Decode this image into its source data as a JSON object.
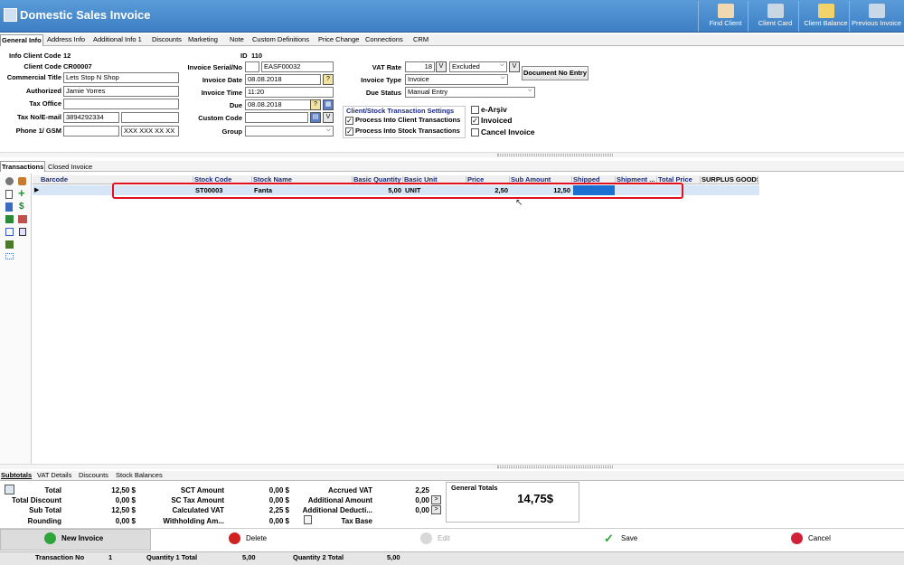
{
  "window": {
    "title": "Domestic Sales Invoice"
  },
  "toolbar": [
    {
      "label": "Find Client",
      "icon": "find-client-icon",
      "color": "#f0d8b0"
    },
    {
      "label": "Client Card",
      "icon": "client-card-icon",
      "color": "#c9d7e3"
    },
    {
      "label": "Client Balance",
      "icon": "client-balance-icon",
      "color": "#f1d36a"
    },
    {
      "label": "Previous Invoice",
      "icon": "previous-invoice-icon",
      "color": "#c8d8e8"
    }
  ],
  "tabs": [
    "General Info",
    "Address Info",
    "Additional Info 1",
    "Discounts",
    "Marketing",
    "Note",
    "Custom Definitions",
    "Price Change",
    "Connections",
    "CRM"
  ],
  "client": {
    "info_code_label": "Info Client Code",
    "info_code_value": "12",
    "code_label": "Client Code",
    "code_value": "CR00007",
    "commercial_title_label": "Commercial Title",
    "commercial_title_value": "Lets Stop N Shop",
    "authorized_label": "Authorized",
    "authorized_value": "Jamie  Yorres",
    "tax_office_label": "Tax Office",
    "tax_office_value": "",
    "tax_no_label": "Tax No/E-mail",
    "tax_no_value": "3894292334",
    "phone_label": "Phone 1/ GSM",
    "phone_gsm_value": "XXX XXX XX XX"
  },
  "invoice": {
    "id_label": "ID",
    "id_value": "110",
    "serial_label": "Invoice Serial/No",
    "serial_value": "EASF00032",
    "date_label": "Invoice Date",
    "date_value": "08.08.2018",
    "time_label": "Invoice Time",
    "time_value": "11:20",
    "due_label": "Due",
    "due_value": "08.08.2018",
    "custom_code_label": "Custom Code",
    "custom_code_value": "",
    "group_label": "Group",
    "group_value": "",
    "vat_rate_label": "VAT Rate",
    "vat_rate_value": "18",
    "vat_v": "V",
    "vat_mode_value": "Excluded",
    "vat_mode_v": "V",
    "document_no_entry": "Document No Entry",
    "type_label": "Invoice Type",
    "type_value": "Invoice",
    "due_status_label": "Due Status",
    "due_status_value": "Manual Entry"
  },
  "settings": {
    "title": "Client/Stock Transaction Settings",
    "process_client": "Process Into Client Transactions",
    "process_client_checked": true,
    "process_stock": "Process Into Stock Transactions",
    "process_stock_checked": true
  },
  "options": {
    "earsiv": "e-Arşiv",
    "earsiv_checked": false,
    "invoiced": "Invoiced",
    "invoiced_checked": true,
    "cancel": "Cancel Invoice",
    "cancel_checked": false
  },
  "transaction_tabs": [
    "Transactions",
    "Closed Invoice"
  ],
  "grid": {
    "columns": [
      "Barcode",
      "Stock Code",
      "Stock Name",
      "Basic Quantity",
      "Basic Unit",
      "Price",
      "Sub Amount",
      "Shipped",
      "Shipment ...",
      "Total Price",
      "SURPLUS GOODS"
    ],
    "rows": [
      {
        "barcode": "",
        "stock_code": "ST00003",
        "stock_name": "Fanta",
        "quantity": "5,00",
        "unit": "UNIT",
        "price": "2,50",
        "sub_amount": "12,50",
        "shipped": "",
        "shipment": "",
        "total_price": "",
        "surplus": ""
      }
    ],
    "highlight_color": "#e0101c",
    "selected_color": "#1a6fd0"
  },
  "subtotal_tabs": [
    "Subtotals",
    "VAT Details",
    "Discounts",
    "Stock Balances"
  ],
  "subtotals": {
    "total_label": "Total",
    "total": "12,50 $",
    "total_discount_label": "Total Discount",
    "total_discount": "0,00 $",
    "sub_total_label": "Sub Total",
    "sub_total": "12,50 $",
    "rounding_label": "Rounding",
    "rounding": "0,00 $",
    "sct_label": "SCT Amount",
    "sct": "0,00 $",
    "sct_tax_label": "SC Tax Amount",
    "sct_tax": "0,00 $",
    "calc_vat_label": "Calculated VAT",
    "calc_vat": "2,25 $",
    "withholding_label": "Withholding Am...",
    "withholding": "0,00 $",
    "accrued_vat_label": "Accrued VAT",
    "accrued_vat": "2,25",
    "additional_amount_label": "Additional Amount",
    "additional_amount": "0,00",
    "additional_deduct_label": "Additional Deducti...",
    "additional_deduct": "0,00",
    "tax_base_label": "Tax Base",
    "general_totals_label": "General Totals",
    "general_totals": "14,75$"
  },
  "actions": {
    "new_invoice": "New Invoice",
    "delete": "Delete",
    "edit": "Edit",
    "save": "Save",
    "cancel": "Cancel"
  },
  "status": {
    "transaction_no_label": "Transaction No",
    "transaction_no": "1",
    "qty1_label": "Quantity 1 Total",
    "qty1": "5,00",
    "qty2_label": "Quantity 2 Total",
    "qty2": "5,00"
  }
}
